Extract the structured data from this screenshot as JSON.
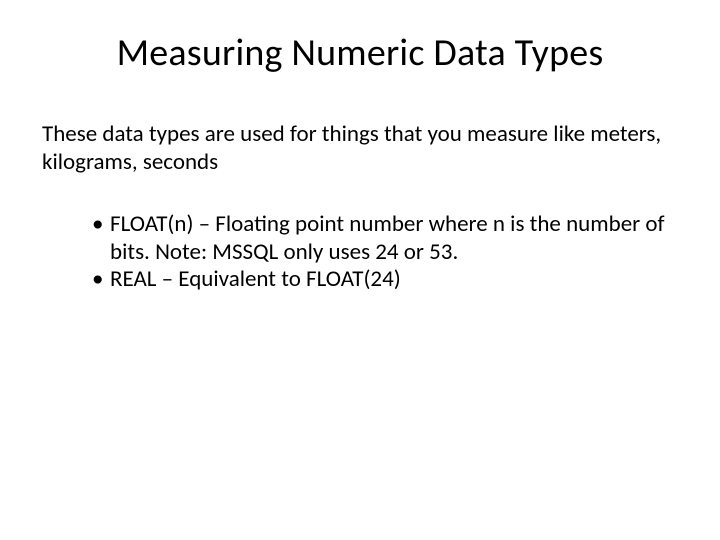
{
  "title": "Measuring Numeric Data Types",
  "intro": "These data types are used for things that you measure like meters, kilograms, seconds",
  "bullets": [
    "FLOAT(n) – Floating point number where n is the number of bits. Note: MSSQL only uses 24 or 53.",
    "REAL – Equivalent to FLOAT(24)"
  ]
}
